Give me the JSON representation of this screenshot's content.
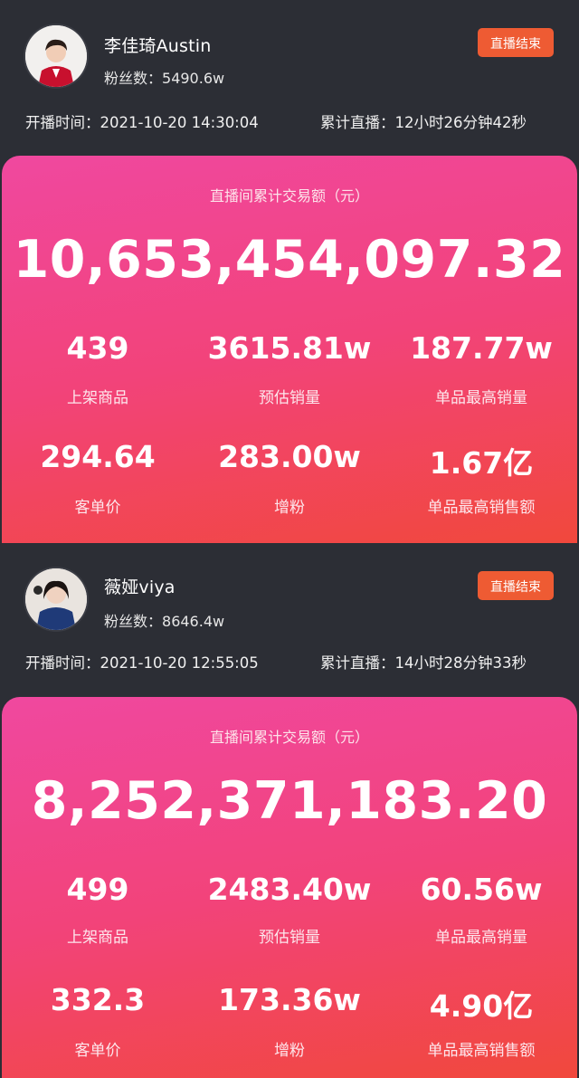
{
  "streamers": [
    {
      "name": "李佳琦Austin",
      "fans_label": "粉丝数：",
      "fans": "5490.6w",
      "status": "直播结束",
      "start_label": "开播时间：",
      "start_time": "2021-10-20 14:30:04",
      "duration_label": "累计直播：",
      "duration": "12小时26分钟42秒",
      "total_label": "直播间累计交易额（元）",
      "total": "10,653,454,097.32",
      "stats": [
        {
          "value": "439",
          "label": "上架商品"
        },
        {
          "value": "3615.81w",
          "label": "预估销量"
        },
        {
          "value": "187.77w",
          "label": "单品最高销量"
        },
        {
          "value": "294.64",
          "label": "客单价"
        },
        {
          "value": "283.00w",
          "label": "增粉"
        },
        {
          "value": "1.67亿",
          "label": "单品最高销售额"
        }
      ]
    },
    {
      "name": "薇娅viya",
      "fans_label": "粉丝数：",
      "fans": "8646.4w",
      "status": "直播结束",
      "start_label": "开播时间：",
      "start_time": "2021-10-20 12:55:05",
      "duration_label": "累计直播：",
      "duration": "14小时28分钟33秒",
      "total_label": "直播间累计交易额（元）",
      "total": "8,252,371,183.20",
      "stats": [
        {
          "value": "499",
          "label": "上架商品"
        },
        {
          "value": "2483.40w",
          "label": "预估销量"
        },
        {
          "value": "60.56w",
          "label": "单品最高销量"
        },
        {
          "value": "332.3",
          "label": "客单价"
        },
        {
          "value": "173.36w",
          "label": "增粉"
        },
        {
          "value": "4.90亿",
          "label": "单品最高销售额"
        }
      ]
    }
  ],
  "colors": {
    "background": "#2c2e35",
    "status_button": "#ee5b33",
    "card_gradient_start": "#f0489f",
    "card_gradient_end": "#f1483c"
  }
}
